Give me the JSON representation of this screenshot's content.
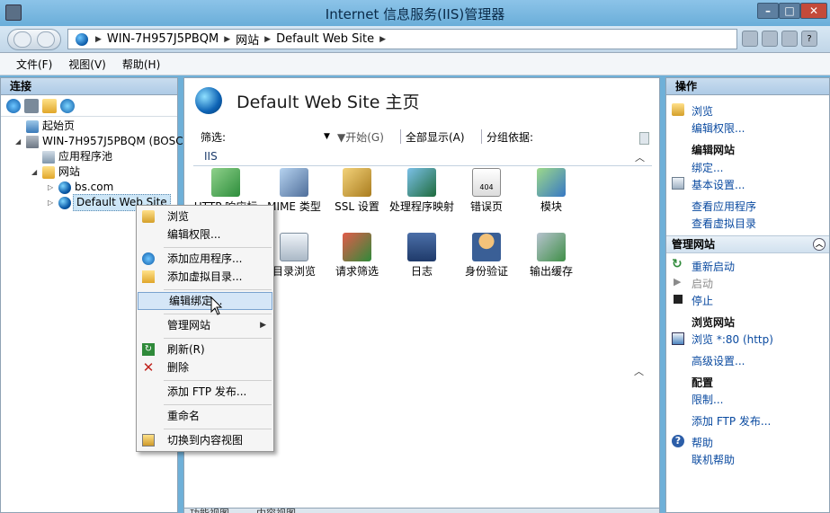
{
  "window": {
    "title": "Internet 信息服务(IIS)管理器"
  },
  "address": {
    "segments": [
      "WIN-7H957J5PBQM",
      "网站",
      "Default Web Site"
    ]
  },
  "menu": [
    "文件(F)",
    "视图(V)",
    "帮助(H)"
  ],
  "left": {
    "header": "连接",
    "tree": [
      {
        "label": "起始页",
        "icon": "start-page-icon"
      },
      {
        "label": "WIN-7H957J5PBQM (BOSC",
        "icon": "server-icon"
      },
      {
        "label": "应用程序池",
        "icon": "app-pool-icon"
      },
      {
        "label": "网站",
        "icon": "sites-folder-icon"
      },
      {
        "label": "bs.com",
        "icon": "globe-icon"
      },
      {
        "label": "Default Web Site",
        "icon": "globe-icon"
      }
    ]
  },
  "center": {
    "title": "Default Web Site 主页",
    "filter": {
      "label": "筛选:",
      "start": "开始(G)",
      "show_all": "全部显示(A)",
      "group_by": "分组依据:"
    },
    "group": "IIS",
    "features": [
      {
        "label": "HTTP 响应标",
        "icon": "http-response-icon"
      },
      {
        "label": "MIME 类型",
        "icon": "mime-types-icon"
      },
      {
        "label": "SSL 设置",
        "icon": "ssl-lock-icon"
      },
      {
        "label": "处理程序映射",
        "icon": "handler-mappings-icon"
      },
      {
        "label": "错误页",
        "icon": "error-pages-icon"
      },
      {
        "label": "模块",
        "icon": "modules-icon"
      },
      {
        "label": "目录浏览",
        "icon": "directory-browsing-icon"
      },
      {
        "label": "请求筛选",
        "icon": "request-filtering-icon"
      },
      {
        "label": "日志",
        "icon": "logging-icon"
      },
      {
        "label": "身份验证",
        "icon": "authentication-icon"
      },
      {
        "label": "输出缓存",
        "icon": "output-caching-icon"
      }
    ],
    "error_badge": "404",
    "bottom_tabs": [
      "功能视图",
      "内容视图"
    ]
  },
  "right": {
    "header": "操作",
    "browse": "浏览",
    "edit_perms": "编辑权限...",
    "edit_site": "编辑网站",
    "bindings": "绑定...",
    "basic_settings": "基本设置...",
    "view_apps": "查看应用程序",
    "view_vdirs": "查看虚拟目录",
    "manage_site": "管理网站",
    "restart": "重新启动",
    "start": "启动",
    "stop": "停止",
    "browse_site": "浏览网站",
    "browse_80": "浏览 *:80 (http)",
    "advanced": "高级设置...",
    "config": "配置",
    "limits": "限制...",
    "add_ftp": "添加 FTP 发布...",
    "help": "帮助",
    "online_help": "联机帮助"
  },
  "context_menu": {
    "browse": "浏览",
    "edit_perms": "编辑权限...",
    "add_app": "添加应用程序...",
    "add_vdir": "添加虚拟目录...",
    "edit_bindings": "编辑绑定...",
    "manage_site": "管理网站",
    "refresh": "刷新(R)",
    "delete": "删除",
    "add_ftp": "添加 FTP 发布...",
    "rename": "重命名",
    "switch_content": "切换到内容视图"
  }
}
